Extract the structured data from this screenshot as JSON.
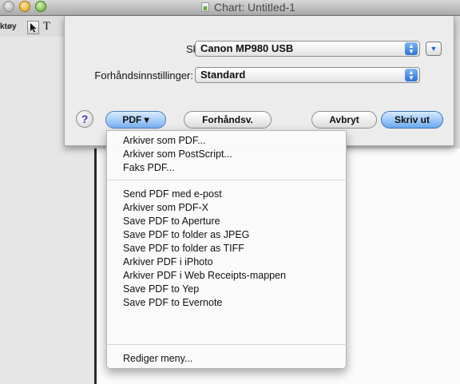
{
  "window": {
    "title": "Chart: Untitled-1"
  },
  "toolbar": {
    "label": "ktøy",
    "pointer_icon": "arrow-pointer-icon",
    "text_tool_glyph": "T"
  },
  "print_sheet": {
    "printer_label": "Skriver:",
    "printer_value": "Canon MP980 USB",
    "presets_label": "Forhåndsinnstillinger:",
    "presets_value": "Standard",
    "help_label": "?",
    "pdf_button": "PDF ▾",
    "preview_button": "Forhåndsv.",
    "cancel_button": "Avbryt",
    "print_button": "Skriv ut",
    "expand_icon": "disclosure-triangle-icon"
  },
  "pdf_menu": {
    "group1": [
      "Arkiver som PDF...",
      "Arkiver som PostScript...",
      "Faks PDF..."
    ],
    "group2": [
      "Send PDF med e-post",
      "Arkiver som PDF-X",
      "Save PDF to Aperture",
      "Save PDF to folder as JPEG",
      "Save PDF to folder as TIFF",
      "Arkiver PDF i iPhoto",
      "Arkiver PDF i Web Receipts-mappen",
      "Save PDF to Yep",
      "Save PDF to Evernote"
    ],
    "group3": [
      "Rediger meny..."
    ]
  },
  "colors": {
    "accent_blue": "#6aa8ee",
    "sheet_bg": "#ececec"
  }
}
